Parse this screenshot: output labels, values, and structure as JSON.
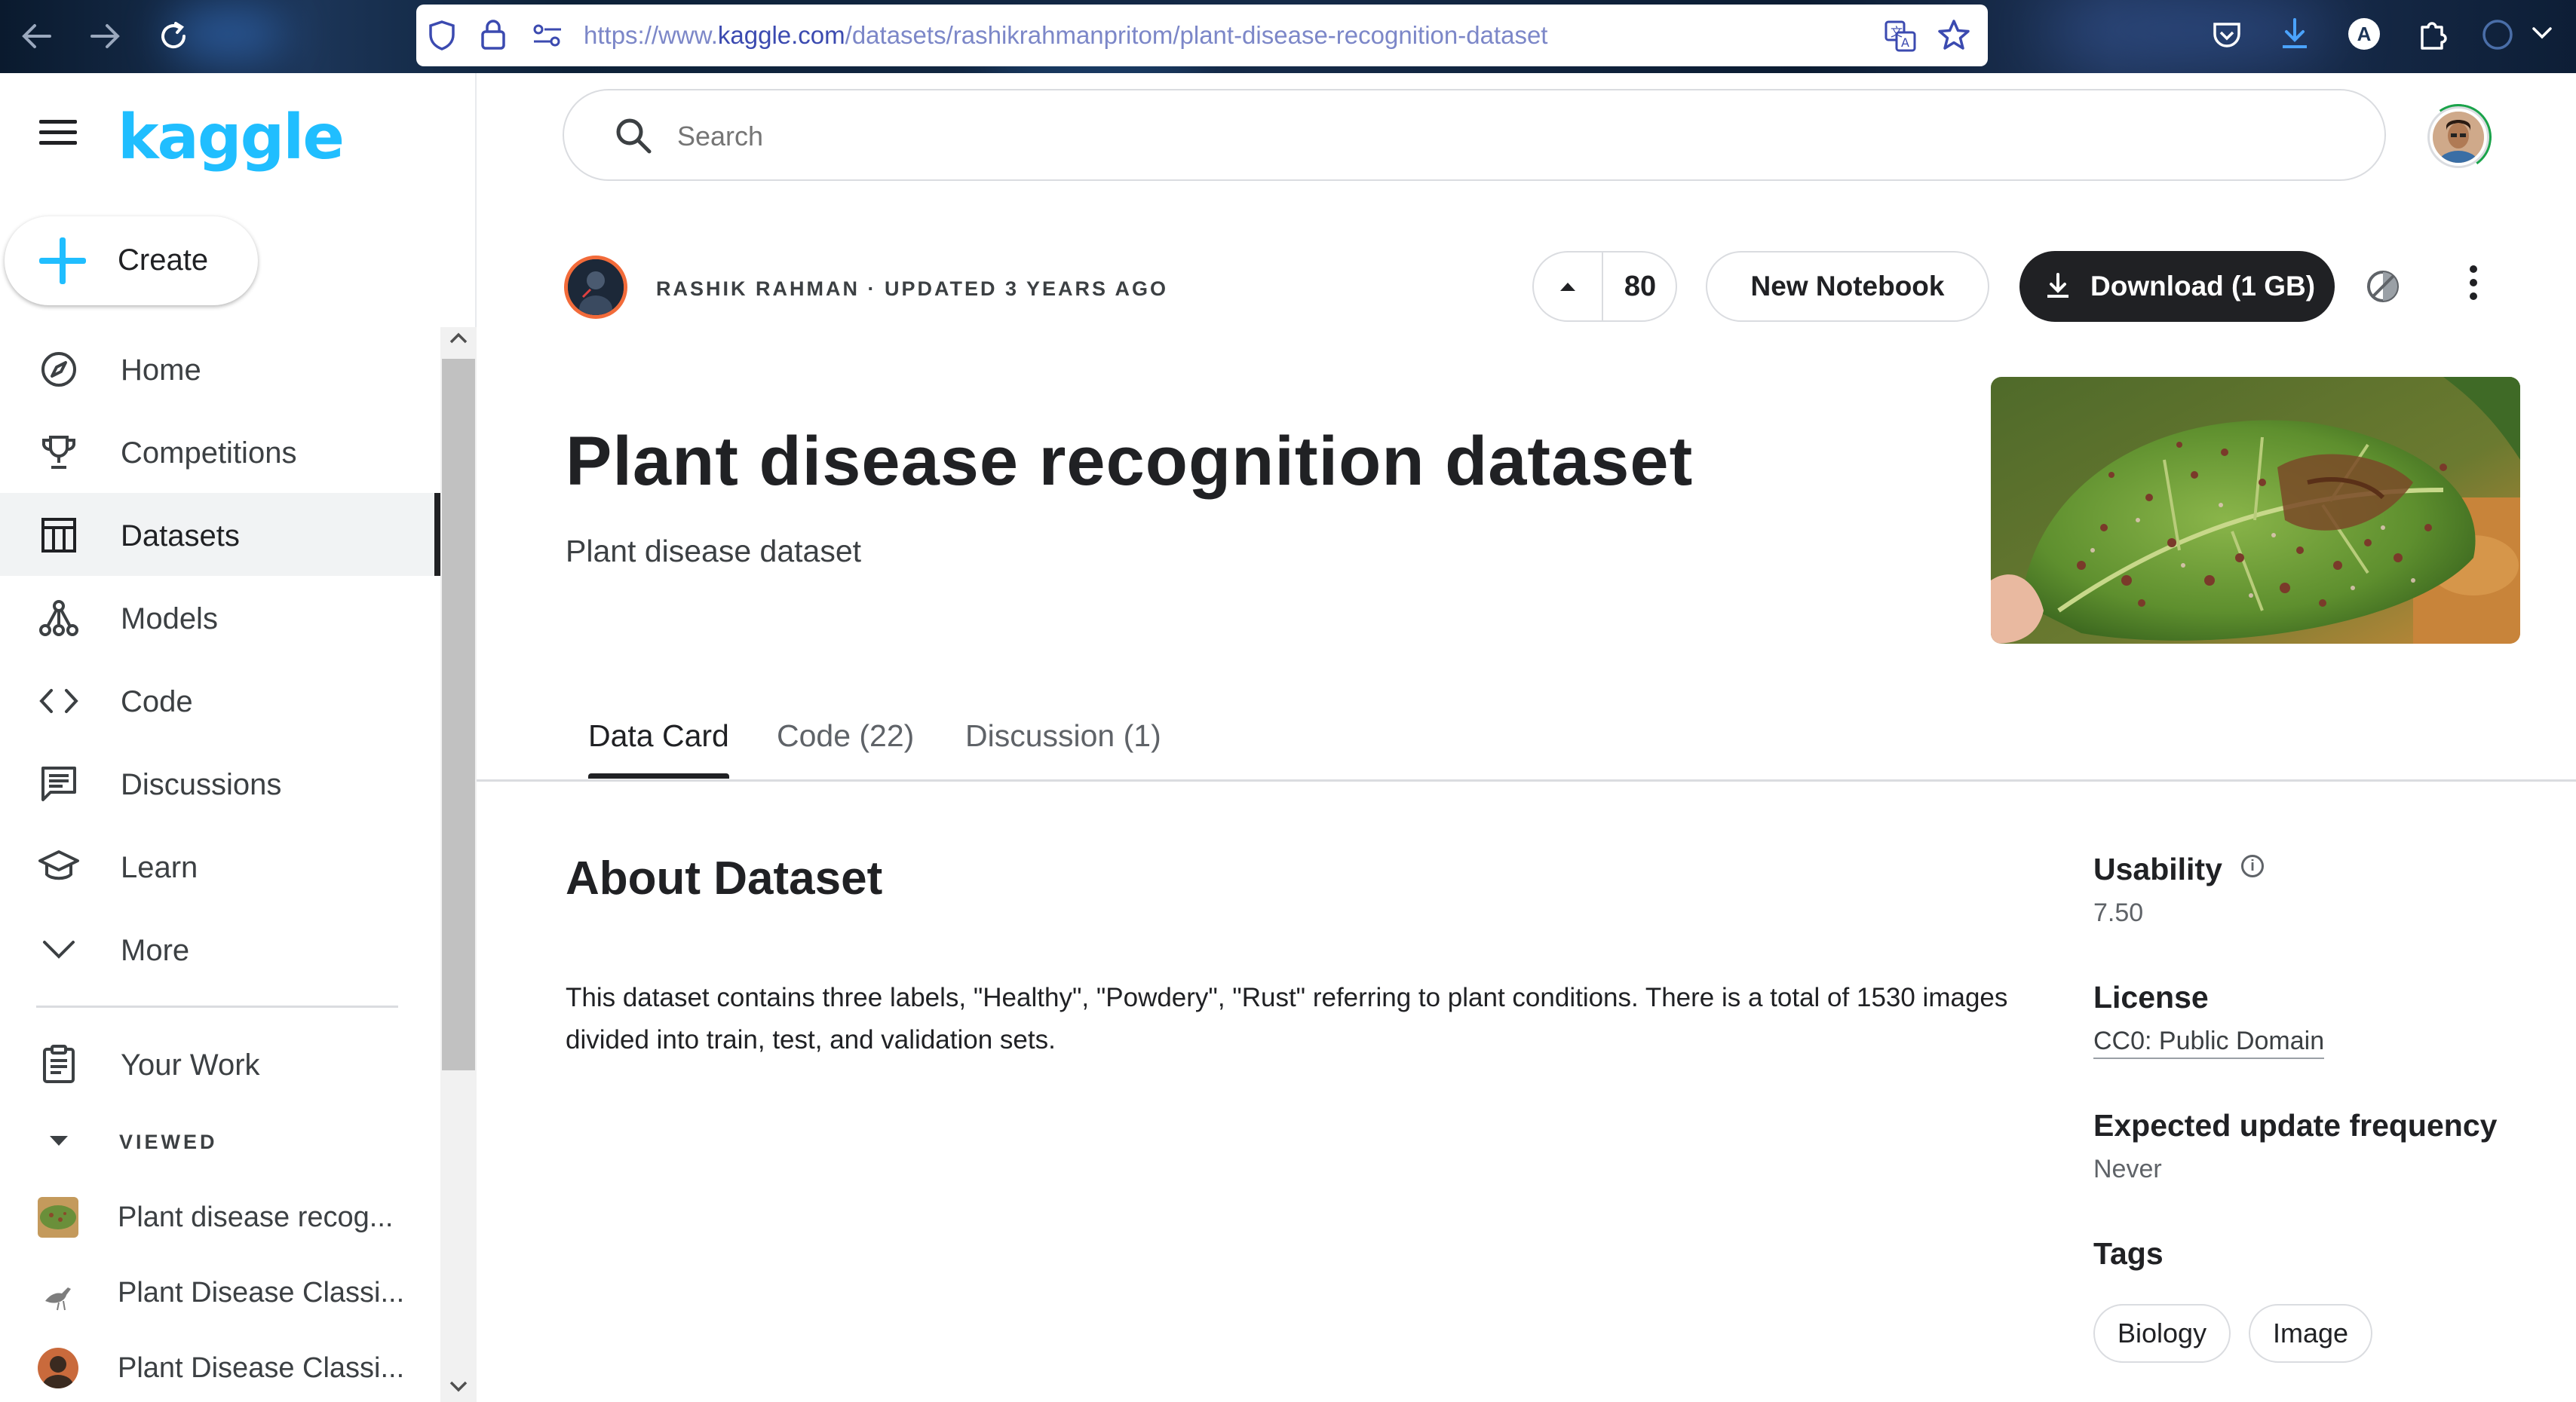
{
  "browser": {
    "url_prefix": "https://www.",
    "url_host": "kaggle.com",
    "url_path": "/datasets/rashikrahmanpritom/plant-disease-recognition-dataset",
    "profile_initial": "A"
  },
  "sidebar": {
    "logo": "kaggle",
    "create_label": "Create",
    "items": [
      {
        "label": "Home",
        "icon": "compass-icon"
      },
      {
        "label": "Competitions",
        "icon": "trophy-icon"
      },
      {
        "label": "Datasets",
        "icon": "table-icon",
        "active": true
      },
      {
        "label": "Models",
        "icon": "models-icon"
      },
      {
        "label": "Code",
        "icon": "code-icon"
      },
      {
        "label": "Discussions",
        "icon": "discussions-icon"
      },
      {
        "label": "Learn",
        "icon": "graduation-cap-icon"
      },
      {
        "label": "More",
        "icon": "chevron-down-icon"
      }
    ],
    "your_work_label": "Your Work",
    "viewed_label": "VIEWED",
    "recent": [
      {
        "label": "Plant disease recog..."
      },
      {
        "label": "Plant Disease Classi..."
      },
      {
        "label": "Plant Disease Classi..."
      }
    ]
  },
  "search": {
    "placeholder": "Search"
  },
  "dataset": {
    "author_line": "RASHIK RAHMAN · UPDATED 3 YEARS AGO",
    "votes": "80",
    "new_notebook_label": "New Notebook",
    "download_label": "Download (1 GB)",
    "title": "Plant disease recognition dataset",
    "subtitle": "Plant disease dataset"
  },
  "tabs": [
    {
      "label": "Data Card",
      "active": true
    },
    {
      "label": "Code (22)"
    },
    {
      "label": "Discussion (1)"
    }
  ],
  "about": {
    "heading": "About Dataset",
    "text": "This dataset contains three labels, \"Healthy\", \"Powdery\", \"Rust\" referring to plant conditions. There is a total of 1530 images divided into train, test, and validation sets."
  },
  "meta": {
    "usability_label": "Usability",
    "usability_value": "7.50",
    "license_label": "License",
    "license_value": "CC0: Public Domain",
    "frequency_label": "Expected update frequency",
    "frequency_value": "Never",
    "tags_label": "Tags",
    "tags": [
      "Biology",
      "Image"
    ]
  },
  "colors": {
    "brand": "#20beff",
    "primary_button": "#202124",
    "author_ring": "#f26b3a"
  }
}
